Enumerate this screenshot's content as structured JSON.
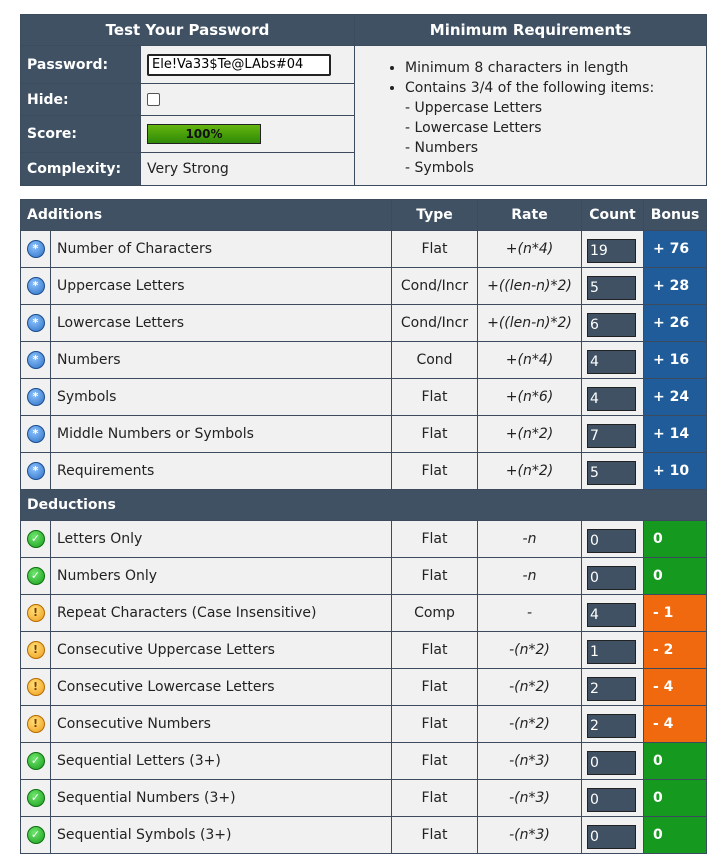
{
  "top": {
    "title_left": "Test Your Password",
    "title_right": "Minimum Requirements",
    "password_label": "Password:",
    "password_value": "Ele!Va33$Te@LAbs#04",
    "hide_label": "Hide:",
    "score_label": "Score:",
    "score_value": "100%",
    "score_fraction": 1.0,
    "complexity_label": "Complexity:",
    "complexity_value": "Very Strong",
    "requirements": {
      "item1": "Minimum 8 characters in length",
      "item2": "Contains 3/4 of the following items:",
      "sub": [
        "- Uppercase Letters",
        "- Lowercase Letters",
        "- Numbers",
        "- Symbols"
      ]
    }
  },
  "headers": {
    "additions": "Additions",
    "type": "Type",
    "rate": "Rate",
    "count": "Count",
    "bonus": "Bonus",
    "deductions": "Deductions"
  },
  "additions": [
    {
      "name": "Number of Characters",
      "type": "Flat",
      "rate": "+(n*4)",
      "count": "19",
      "bonus": "+ 76",
      "icon": "info-icon",
      "status": "blue"
    },
    {
      "name": "Uppercase Letters",
      "type": "Cond/Incr",
      "rate": "+((len-n)*2)",
      "count": "5",
      "bonus": "+ 28",
      "icon": "info-icon",
      "status": "blue"
    },
    {
      "name": "Lowercase Letters",
      "type": "Cond/Incr",
      "rate": "+((len-n)*2)",
      "count": "6",
      "bonus": "+ 26",
      "icon": "info-icon",
      "status": "blue"
    },
    {
      "name": "Numbers",
      "type": "Cond",
      "rate": "+(n*4)",
      "count": "4",
      "bonus": "+ 16",
      "icon": "info-icon",
      "status": "blue"
    },
    {
      "name": "Symbols",
      "type": "Flat",
      "rate": "+(n*6)",
      "count": "4",
      "bonus": "+ 24",
      "icon": "info-icon",
      "status": "blue"
    },
    {
      "name": "Middle Numbers or Symbols",
      "type": "Flat",
      "rate": "+(n*2)",
      "count": "7",
      "bonus": "+ 14",
      "icon": "info-icon",
      "status": "blue"
    },
    {
      "name": "Requirements",
      "type": "Flat",
      "rate": "+(n*2)",
      "count": "5",
      "bonus": "+ 10",
      "icon": "info-icon",
      "status": "blue"
    }
  ],
  "deductions": [
    {
      "name": "Letters Only",
      "type": "Flat",
      "rate": "-n",
      "count": "0",
      "bonus": "0",
      "icon": "check-icon",
      "status": "green"
    },
    {
      "name": "Numbers Only",
      "type": "Flat",
      "rate": "-n",
      "count": "0",
      "bonus": "0",
      "icon": "check-icon",
      "status": "green"
    },
    {
      "name": "Repeat Characters (Case Insensitive)",
      "type": "Comp",
      "rate": "-",
      "count": "4",
      "bonus": "- 1",
      "icon": "warning-icon",
      "status": "orange"
    },
    {
      "name": "Consecutive Uppercase Letters",
      "type": "Flat",
      "rate": "-(n*2)",
      "count": "1",
      "bonus": "- 2",
      "icon": "warning-icon",
      "status": "orange"
    },
    {
      "name": "Consecutive Lowercase Letters",
      "type": "Flat",
      "rate": "-(n*2)",
      "count": "2",
      "bonus": "- 4",
      "icon": "warning-icon",
      "status": "orange"
    },
    {
      "name": "Consecutive Numbers",
      "type": "Flat",
      "rate": "-(n*2)",
      "count": "2",
      "bonus": "- 4",
      "icon": "warning-icon",
      "status": "orange"
    },
    {
      "name": "Sequential Letters (3+)",
      "type": "Flat",
      "rate": "-(n*3)",
      "count": "0",
      "bonus": "0",
      "icon": "check-icon",
      "status": "green"
    },
    {
      "name": "Sequential Numbers (3+)",
      "type": "Flat",
      "rate": "-(n*3)",
      "count": "0",
      "bonus": "0",
      "icon": "check-icon",
      "status": "green"
    },
    {
      "name": "Sequential Symbols (3+)",
      "type": "Flat",
      "rate": "-(n*3)",
      "count": "0",
      "bonus": "0",
      "icon": "check-icon",
      "status": "green"
    }
  ],
  "colors": {
    "header": "#3f5163",
    "bonus_blue": "#1f5c99",
    "bonus_green": "#15991f",
    "bonus_orange": "#f0690f",
    "score_bar": "#2f8a07"
  }
}
